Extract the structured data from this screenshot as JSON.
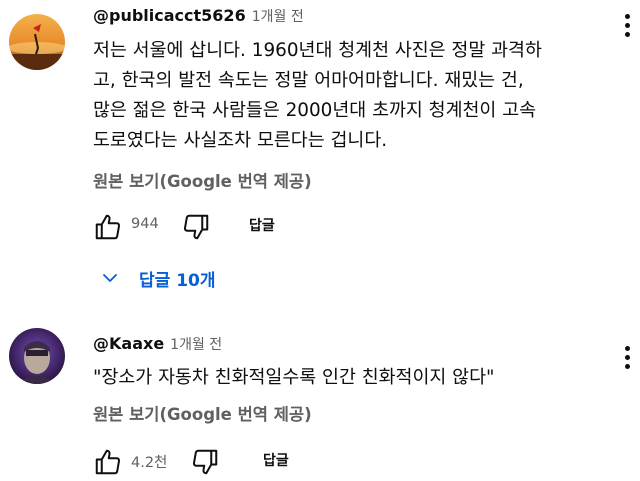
{
  "comments": [
    {
      "author": "@publicacct5626",
      "time": "1개월 전",
      "lines": [
        "저는 서울에 삽니다. 1960년대 청계천 사진은 정말 과격하",
        "고, 한국의 발전 속도는 정말 어마어마합니다. 재밌는 건,",
        "많은 젊은 한국 사람들은 2000년대 초까지 청계천이 고속",
        "도로였다는 사실조차 모른다는 겁니다."
      ],
      "translate": "원본 보기(Google 번역 제공)",
      "likes": "944",
      "reply": "답글",
      "avatar_icon": "sunset-silhouette-avatar",
      "replies_label": "답글 10개"
    },
    {
      "author": "@Kaaxe",
      "time": "1개월 전",
      "lines": [
        "\"장소가 자동차 친화적일수록 인간 친화적이지 않다\""
      ],
      "translate": "원본 보기(Google 번역 제공)",
      "likes": "4.2천",
      "reply": "답글",
      "avatar_icon": "purple-portrait-avatar"
    }
  ],
  "colors": {
    "link": "#065fd4",
    "secondary": "#606060",
    "primary": "#0f0f0f"
  }
}
